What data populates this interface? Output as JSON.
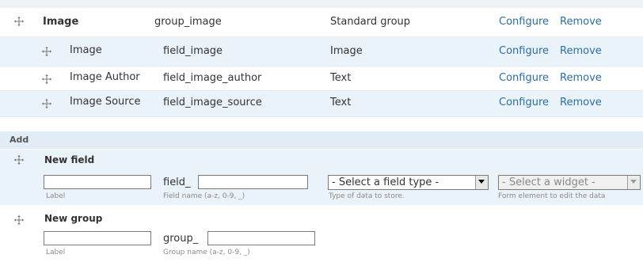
{
  "rows": [
    {
      "label": "Image",
      "name": "group_image",
      "type": "Standard group",
      "configure": "Configure",
      "remove": "Remove"
    },
    {
      "label": "Image",
      "name": "field_image",
      "type": "Image",
      "configure": "Configure",
      "remove": "Remove"
    },
    {
      "label": "Image Author",
      "name": "field_image_author",
      "type": "Text",
      "configure": "Configure",
      "remove": "Remove"
    },
    {
      "label": "Image Source",
      "name": "field_image_source",
      "type": "Text",
      "configure": "Configure",
      "remove": "Remove"
    }
  ],
  "add": {
    "heading": "Add",
    "new_field": {
      "title": "New field",
      "label_hint": "Label",
      "name_prefix": "field_",
      "name_hint": "Field name (a-z, 0-9, _)",
      "type_select": "- Select a field type -",
      "type_hint": "Type of data to store.",
      "widget_select": "- Select a widget -",
      "widget_hint": "Form element to edit the data"
    },
    "new_group": {
      "title": "New group",
      "label_hint": "Label",
      "name_prefix": "group_",
      "name_hint": "Group name (a-z, 0-9, _)"
    }
  },
  "icons": {
    "drag": "move-cross-icon",
    "dropdown": "dropdown-arrow-icon"
  },
  "colors": {
    "link": "#2a6ea6",
    "row_alt": "#eaf2fa",
    "section_head": "#e2ecf6"
  }
}
